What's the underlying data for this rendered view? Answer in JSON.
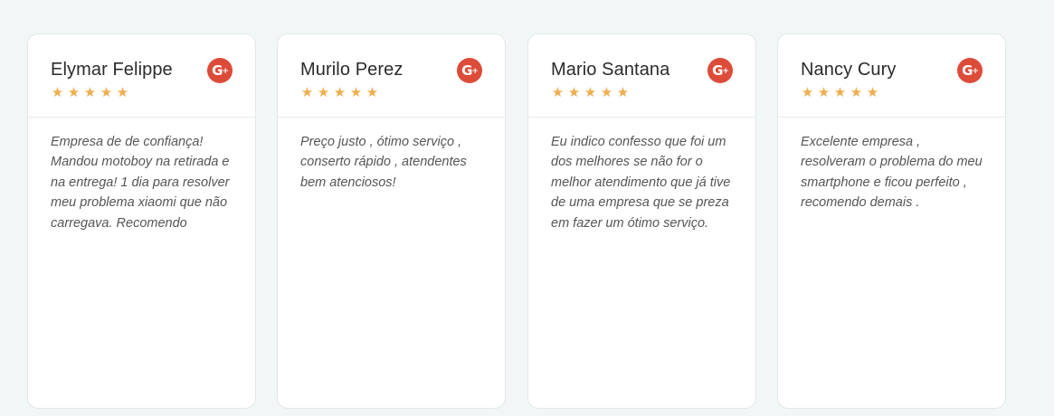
{
  "colors": {
    "background": "#f1f6f6",
    "card": "#ffffff",
    "star": "#f0ad4e",
    "google_plus": "#dd4b39"
  },
  "reviews": [
    {
      "author": "Elymar Felippe",
      "rating": 5,
      "source_icon": "google-plus-icon",
      "source_label": "G+",
      "text": "Empresa de de confiança! Mandou motoboy na retirada e na entrega! 1 dia para resolver meu problema xiaomi que não carregava. Recomendo"
    },
    {
      "author": "Murilo Perez",
      "rating": 5,
      "source_icon": "google-plus-icon",
      "source_label": "G+",
      "text": "Preço justo , ótimo serviço , conserto rápido , atendentes bem atenciosos!"
    },
    {
      "author": "Mario Santana",
      "rating": 5,
      "source_icon": "google-plus-icon",
      "source_label": "G+",
      "text": "Eu indico confesso que foi um dos melhores se não for o melhor atendimento que já tive de uma empresa que se preza em fazer um ótimo serviço."
    },
    {
      "author": "Nancy Cury",
      "rating": 5,
      "source_icon": "google-plus-icon",
      "source_label": "G+",
      "text": "Excelente empresa , resolveram o problema do meu smartphone e ficou perfeito , recomendo demais ."
    }
  ]
}
